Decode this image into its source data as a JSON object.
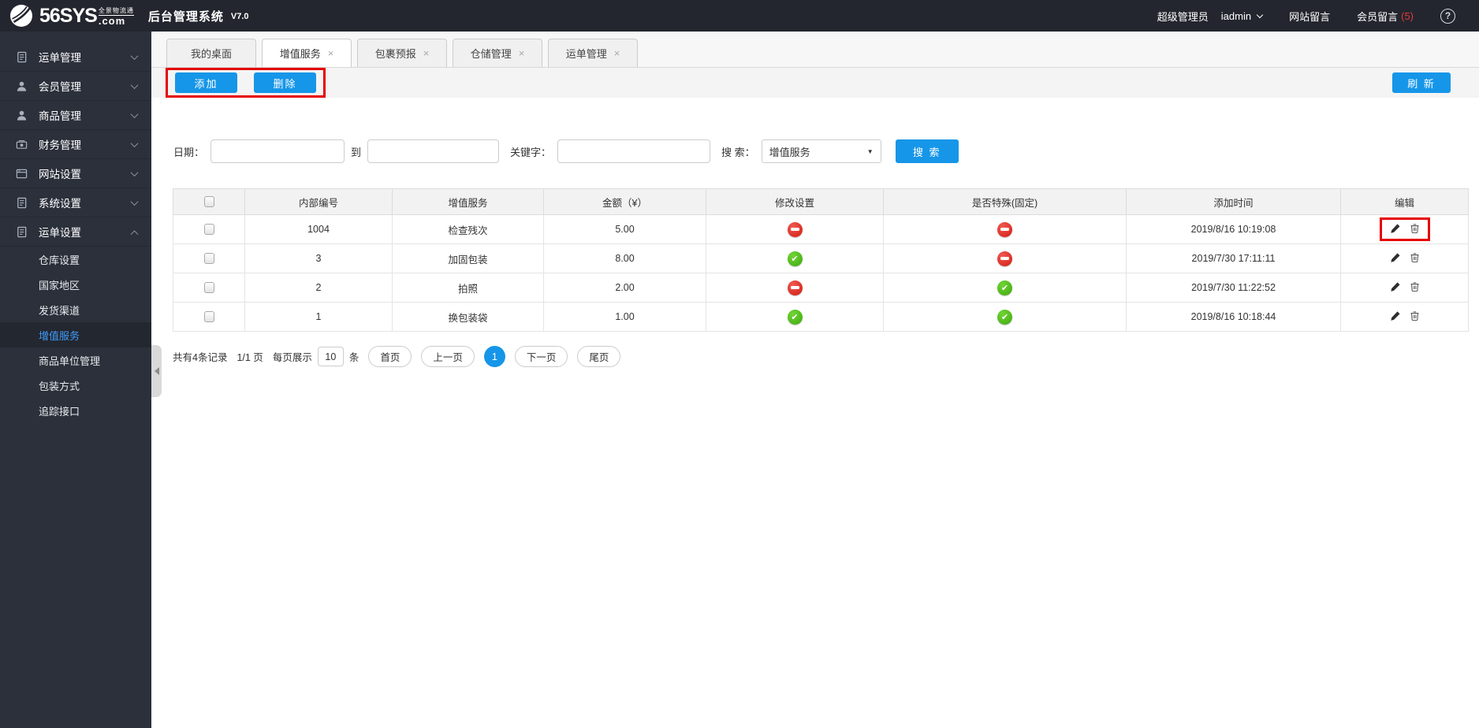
{
  "header": {
    "logo_main": "56SYS",
    "logo_tagline": "全景物流通",
    "logo_domain": ".com",
    "app_title": "后台管理系统",
    "version": "V7.0",
    "role": "超级管理员",
    "username": "iadmin",
    "site_messages_label": "网站留言",
    "member_messages_label": "会员留言",
    "member_messages_count": "(5)"
  },
  "sidebar": {
    "items": [
      {
        "label": "运单管理",
        "icon": "waybill-doc-icon",
        "expanded": false
      },
      {
        "label": "会员管理",
        "icon": "user-icon",
        "expanded": false
      },
      {
        "label": "商品管理",
        "icon": "user-icon",
        "expanded": false
      },
      {
        "label": "财务管理",
        "icon": "finance-icon",
        "expanded": false
      },
      {
        "label": "网站设置",
        "icon": "website-icon",
        "expanded": false
      },
      {
        "label": "系统设置",
        "icon": "system-doc-icon",
        "expanded": false
      },
      {
        "label": "运单设置",
        "icon": "waybill-doc-icon",
        "expanded": true,
        "children": [
          {
            "label": "仓库设置",
            "active": false
          },
          {
            "label": "国家地区",
            "active": false
          },
          {
            "label": "发货渠道",
            "active": false
          },
          {
            "label": "增值服务",
            "active": true
          },
          {
            "label": "商品单位管理",
            "active": false
          },
          {
            "label": "包装方式",
            "active": false
          },
          {
            "label": "追踪接口",
            "active": false
          }
        ]
      }
    ]
  },
  "tabs": [
    {
      "label": "我的桌面",
      "closable": false,
      "active": false
    },
    {
      "label": "增值服务",
      "closable": true,
      "active": true
    },
    {
      "label": "包裹预报",
      "closable": true,
      "active": false
    },
    {
      "label": "仓储管理",
      "closable": true,
      "active": false
    },
    {
      "label": "运单管理",
      "closable": true,
      "active": false
    }
  ],
  "toolbar": {
    "add_label": "添加",
    "delete_label": "删除",
    "refresh_label": "刷 新"
  },
  "filters": {
    "date_label": "日期：",
    "date_from_value": "",
    "to_label": "到",
    "date_to_value": "",
    "keyword_label": "关键字：",
    "keyword_value": "",
    "search_label": "搜 索：",
    "search_select_value": "增值服务",
    "search_button_label": "搜 索"
  },
  "table": {
    "headers": [
      "内部编号",
      "增值服务",
      "金额（¥）",
      "修改设置",
      "是否特殊(固定)",
      "添加时间",
      "编辑"
    ],
    "rows": [
      {
        "id": "1004",
        "service": "检查残次",
        "amount": "5.00",
        "modify": "off",
        "special": "off",
        "time": "2019/8/16 10:19:08",
        "annotated": true
      },
      {
        "id": "3",
        "service": "加固包装",
        "amount": "8.00",
        "modify": "on",
        "special": "off",
        "time": "2019/7/30 17:11:11",
        "annotated": false
      },
      {
        "id": "2",
        "service": "拍照",
        "amount": "2.00",
        "modify": "off",
        "special": "on",
        "time": "2019/7/30 11:22:52",
        "annotated": false
      },
      {
        "id": "1",
        "service": "换包装袋",
        "amount": "1.00",
        "modify": "on",
        "special": "on",
        "time": "2019/8/16 10:18:44",
        "annotated": false
      }
    ]
  },
  "pagination": {
    "summary": "共有4条记录",
    "page_info": "1/1 页",
    "per_page_label": "每页展示",
    "per_page_value": "10",
    "per_page_unit": "条",
    "first_label": "首页",
    "prev_label": "上一页",
    "current_page": "1",
    "next_label": "下一页",
    "last_label": "尾页"
  },
  "annotations": {
    "color": "#e60000",
    "toolbar_buttons_highlighted": true,
    "row1_edit_highlighted": true
  },
  "colors": {
    "accent_blue": "#1696e8",
    "topbar_bg": "#23262e",
    "sidebar_bg": "#2b303b",
    "active_menu_text": "#3f9bfa",
    "status_green": "#4cbb1c",
    "status_red": "#dd241b",
    "annotation_red": "#e60000"
  }
}
